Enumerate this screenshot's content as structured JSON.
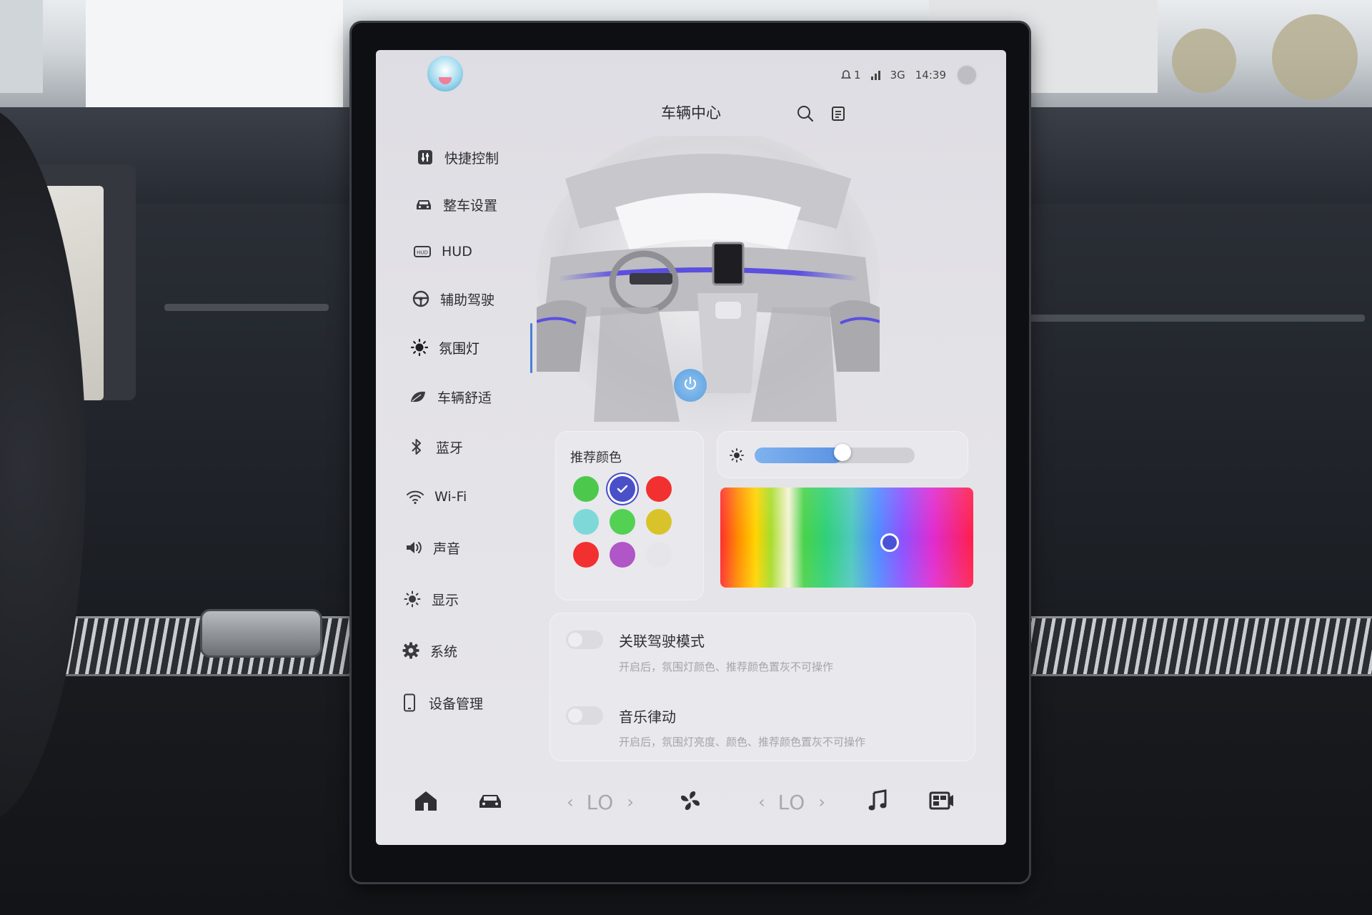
{
  "status_bar": {
    "alert_count": "1",
    "network": "3G",
    "time": "14:39"
  },
  "header": {
    "title": "车辆中心",
    "icons": [
      "search-icon",
      "notes-icon"
    ]
  },
  "sidebar": {
    "items": [
      {
        "label": "快捷控制",
        "icon": "quick-control-icon",
        "active": false
      },
      {
        "label": "整车设置",
        "icon": "car-icon",
        "active": false
      },
      {
        "label": "HUD",
        "icon": "hud-icon",
        "active": false
      },
      {
        "label": "辅助驾驶",
        "icon": "steering-wheel-icon",
        "active": false
      },
      {
        "label": "氛围灯",
        "icon": "ambient-light-icon",
        "active": true
      },
      {
        "label": "车辆舒适",
        "icon": "leaf-icon",
        "active": false
      },
      {
        "label": "蓝牙",
        "icon": "bluetooth-icon",
        "active": false
      },
      {
        "label": "Wi-Fi",
        "icon": "wifi-icon",
        "active": false
      },
      {
        "label": "声音",
        "icon": "speaker-icon",
        "active": false
      },
      {
        "label": "显示",
        "icon": "brightness-icon",
        "active": false
      },
      {
        "label": "系统",
        "icon": "gear-icon",
        "active": false
      },
      {
        "label": "设备管理",
        "icon": "phone-icon",
        "active": false
      }
    ]
  },
  "ambient_light": {
    "recommended_colors_title": "推荐颜色",
    "colors": [
      "#4cc94c",
      "#4a50c8",
      "#f23030",
      "#7fd8d8",
      "#52d152",
      "#d8c42a",
      "#f23030",
      "#b056c6",
      "#e6e6ea"
    ],
    "selected_index": 1,
    "brightness_level": 0.55,
    "spectrum_picker_position": 0.67,
    "accent_color": "#4b7fd6"
  },
  "options": [
    {
      "title": "关联驾驶模式",
      "desc": "开启后，氛围灯颜色、推荐颜色置灰不可操作",
      "enabled": false
    },
    {
      "title": "音乐律动",
      "desc": "开启后，氛围灯亮度、颜色、推荐颜色置灰不可操作",
      "enabled": false
    }
  ],
  "dock": {
    "left_temp": "LO",
    "right_temp": "LO",
    "items": [
      "home-icon",
      "car-icon",
      "fan-icon",
      "music-icon",
      "media-icon"
    ]
  }
}
